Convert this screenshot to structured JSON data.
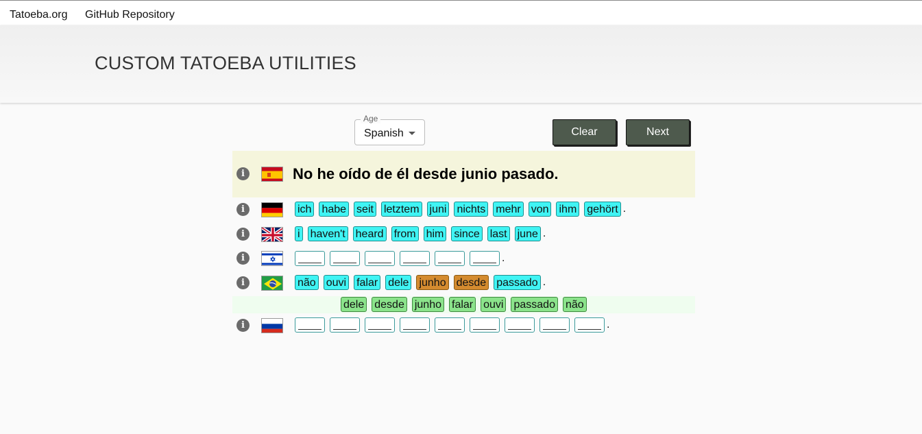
{
  "nav": {
    "link1": "Tatoeba.org",
    "link2": "GitHub Repository"
  },
  "header": {
    "title": "CUSTOM TATOEBA UTILITIES"
  },
  "controls": {
    "select_label": "Age",
    "select_value": "Spanish",
    "clear_label": "Clear",
    "next_label": "Next"
  },
  "main": {
    "sentence": "No he oído de él desde junio pasado.",
    "lang": "Spanish"
  },
  "rows": [
    {
      "lang": "German",
      "words": [
        "ich",
        "habe",
        "seit",
        "letztem",
        "juni",
        "nichts",
        "mehr",
        "von",
        "ihm",
        "gehört"
      ],
      "end": "."
    },
    {
      "lang": "English",
      "words": [
        "i",
        "haven't",
        "heard",
        "from",
        "him",
        "since",
        "last",
        "june"
      ],
      "end": "."
    },
    {
      "lang": "Hebrew",
      "blanks": 6,
      "end": "."
    },
    {
      "lang": "Portuguese",
      "words": [
        "não",
        "ouvi",
        "falar",
        "dele",
        "junho",
        "desde",
        "passado"
      ],
      "highlighted": [
        "junho",
        "desde"
      ],
      "end": "."
    },
    {
      "lang": "Russian",
      "blanks": 9,
      "end": "."
    }
  ],
  "choices": [
    "dele",
    "desde",
    "junho",
    "falar",
    "ouvi",
    "passado",
    "não"
  ],
  "colors": {
    "word": "#40f4f4",
    "wrong": "#d48b2f",
    "choice": "#8be38b",
    "button": "#4e5a4d"
  }
}
